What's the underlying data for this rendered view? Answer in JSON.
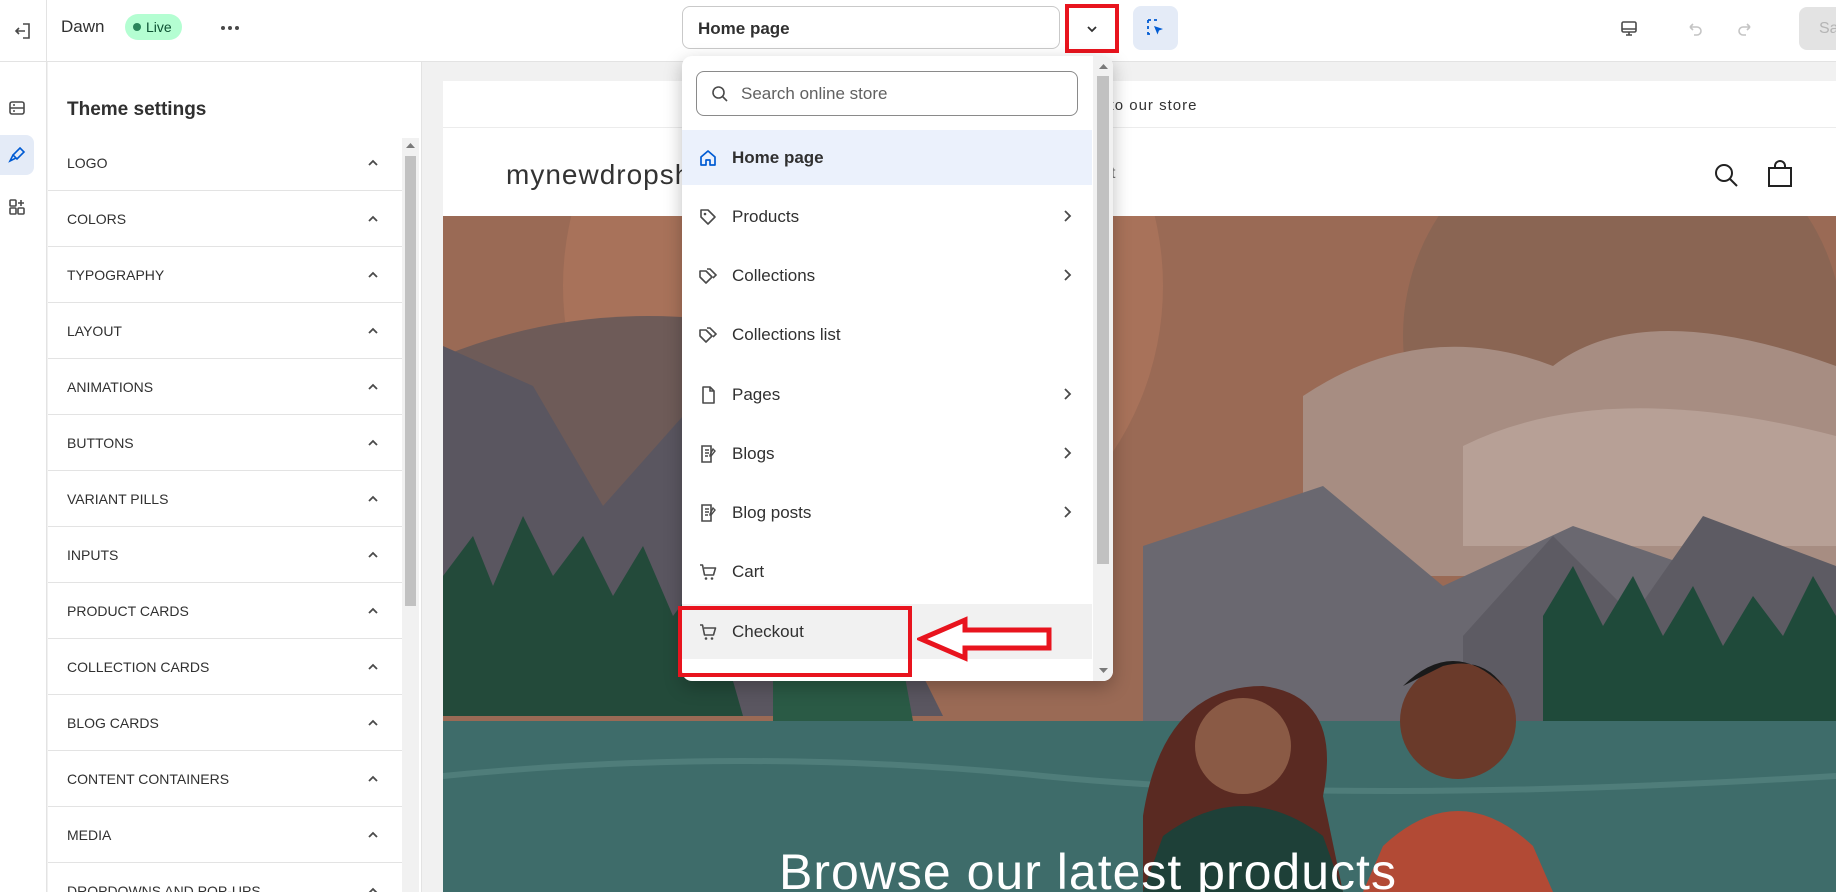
{
  "topbar": {
    "theme_name": "Dawn",
    "live_label": "Live",
    "page_selector_value": "Home page",
    "save_label": "Sa"
  },
  "panel": {
    "title": "Theme settings",
    "sections": [
      {
        "label": "LOGO"
      },
      {
        "label": "COLORS"
      },
      {
        "label": "TYPOGRAPHY"
      },
      {
        "label": "LAYOUT"
      },
      {
        "label": "ANIMATIONS"
      },
      {
        "label": "BUTTONS"
      },
      {
        "label": "VARIANT PILLS"
      },
      {
        "label": "INPUTS"
      },
      {
        "label": "PRODUCT CARDS"
      },
      {
        "label": "COLLECTION CARDS"
      },
      {
        "label": "BLOG CARDS"
      },
      {
        "label": "CONTENT CONTAINERS"
      },
      {
        "label": "MEDIA"
      },
      {
        "label": "DROPDOWNS AND POP-UPS"
      }
    ]
  },
  "dropdown": {
    "search_placeholder": "Search online store",
    "items": [
      {
        "label": "Home page",
        "icon": "home-icon",
        "has_submenu": false,
        "state": "selected"
      },
      {
        "label": "Products",
        "icon": "tag-icon",
        "has_submenu": true
      },
      {
        "label": "Collections",
        "icon": "tags-icon",
        "has_submenu": true
      },
      {
        "label": "Collections list",
        "icon": "tags-icon",
        "has_submenu": false
      },
      {
        "label": "Pages",
        "icon": "page-icon",
        "has_submenu": true
      },
      {
        "label": "Blogs",
        "icon": "blog-icon",
        "has_submenu": true
      },
      {
        "label": "Blog posts",
        "icon": "blog-icon",
        "has_submenu": true
      },
      {
        "label": "Cart",
        "icon": "cart-icon",
        "has_submenu": false
      },
      {
        "label": "Checkout",
        "icon": "cart-icon",
        "has_submenu": false,
        "state": "hover"
      }
    ]
  },
  "preview": {
    "announcement": "me to our store",
    "store_logo": "mynewdropsh",
    "nav_hint": "t",
    "hero_headline": "Browse our latest products"
  },
  "colors": {
    "accent": "#005bd3",
    "annotation_red": "#e8141e",
    "live_badge_bg": "#b4fed2"
  }
}
